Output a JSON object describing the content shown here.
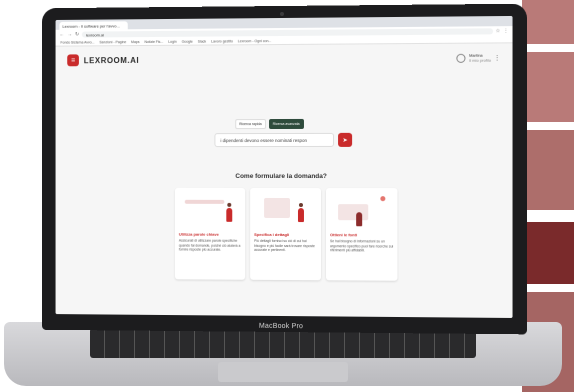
{
  "browser": {
    "tab_title": "Lexroom - Il software per l'avvo...",
    "url": "lexroom.ai",
    "bookmarks": [
      "Fondo Sistema Avvo...",
      "Sanzioni - Pagine",
      "Maps",
      "Notizie Fis...",
      "Login",
      "Google",
      "Slack",
      "Lavoro gestito",
      "Lexroom - Ogni con..."
    ]
  },
  "app": {
    "logo": "LEXROOM.AI",
    "user_name": "Martina",
    "user_sub": "Il mio profilo",
    "modes": [
      "Ricerca rapida",
      "Ricerca avanzata"
    ],
    "search_value": "i dipendenti devono essere nominati respon",
    "section_title": "Come formulare la domanda?",
    "cards": [
      {
        "title": "Utilizza parole chiave",
        "body": "Assicurati di utilizzare parole specifiche quando fai domande, poiché ciò aiuterà a fornire risposte più accurate."
      },
      {
        "title": "Specifica i dettagli",
        "body": "Più dettagli fornisci su ciò di cui hai bisogno e più facile sarà trovare risposte accurate e pertinenti."
      },
      {
        "title": "Ottieni le fonti",
        "body": "Se hai bisogno di informazioni su un argomento specifico puoi fare ricerche sui riferimenti più affidabili."
      }
    ]
  },
  "laptop_label": "MacBook Pro",
  "colors": {
    "accent": "#c92b2b",
    "mode_active": "#2e4b3c",
    "wall": "#b97a78"
  }
}
